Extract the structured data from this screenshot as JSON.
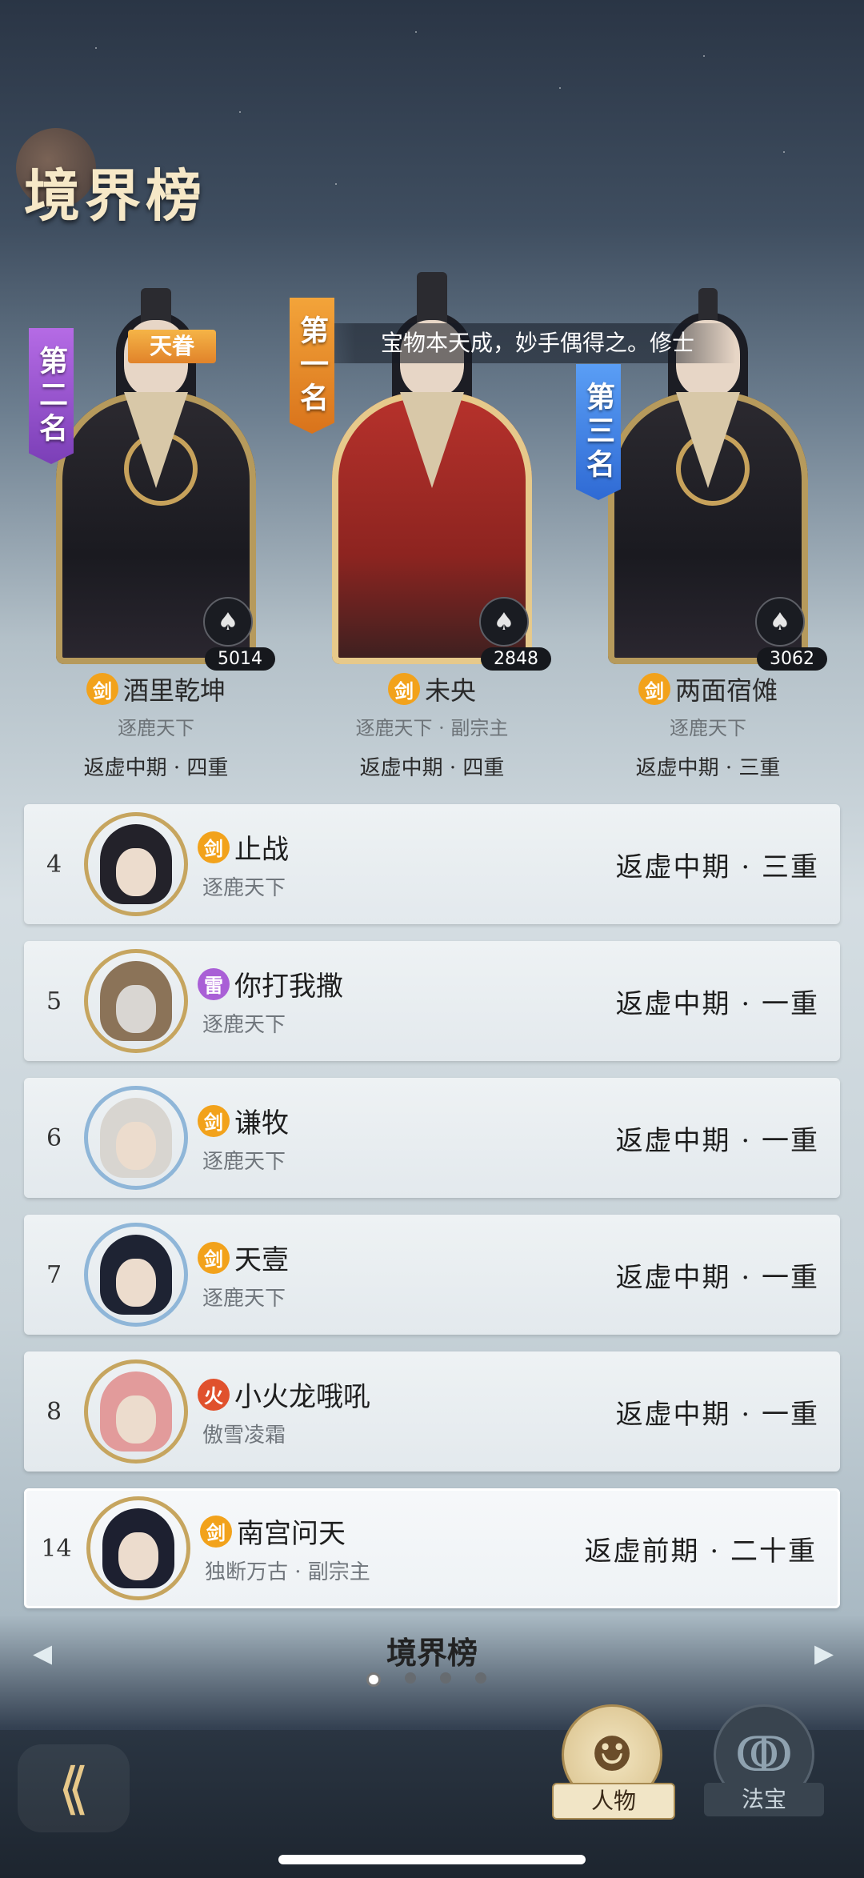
{
  "header": {
    "title": "境界榜"
  },
  "marquee": {
    "text": "宝物本天成，妙手偶得之。修士"
  },
  "top3": [
    {
      "rank_label": "第二名",
      "badge": "天眷",
      "power": "5014",
      "element": "剑",
      "name": "酒里乾坤",
      "guild": "逐鹿天下",
      "realm": "返虚中期 · 四重"
    },
    {
      "rank_label": "第一名",
      "badge": "",
      "power": "2848",
      "element": "剑",
      "name": "未央",
      "guild": "逐鹿天下 · 副宗主",
      "realm": "返虚中期 · 四重"
    },
    {
      "rank_label": "第三名",
      "badge": "",
      "power": "3062",
      "element": "剑",
      "name": "两面宿傩",
      "guild": "逐鹿天下",
      "realm": "返虚中期 · 三重"
    }
  ],
  "rows": [
    {
      "rank": "4",
      "element": "剑",
      "name": "止战",
      "guild": "逐鹿天下",
      "realm": "返虚中期 · 三重"
    },
    {
      "rank": "5",
      "element": "雷",
      "name": "你打我撒",
      "guild": "逐鹿天下",
      "realm": "返虚中期 · 一重"
    },
    {
      "rank": "6",
      "element": "剑",
      "name": "谦牧",
      "guild": "逐鹿天下",
      "realm": "返虚中期 · 一重"
    },
    {
      "rank": "7",
      "element": "剑",
      "name": "天壹",
      "guild": "逐鹿天下",
      "realm": "返虚中期 · 一重"
    },
    {
      "rank": "8",
      "element": "火",
      "name": "小火龙哦吼",
      "guild": "傲雪凌霜",
      "realm": "返虚中期 · 一重"
    }
  ],
  "self_row": {
    "rank": "14",
    "element": "剑",
    "name": "南宫问天",
    "guild": "独断万古 · 副宗主",
    "realm": "返虚前期 · 二十重"
  },
  "footer": {
    "page_title": "境界榜",
    "page_dots": 4,
    "active_page": 1,
    "tabs": [
      {
        "label": "人物",
        "active": true
      },
      {
        "label": "法宝",
        "active": false
      }
    ]
  },
  "colors": {
    "sword": "#f2a21b",
    "thunder": "#a95fd6",
    "fire": "#e0512d",
    "gold": "#c6a55f"
  }
}
